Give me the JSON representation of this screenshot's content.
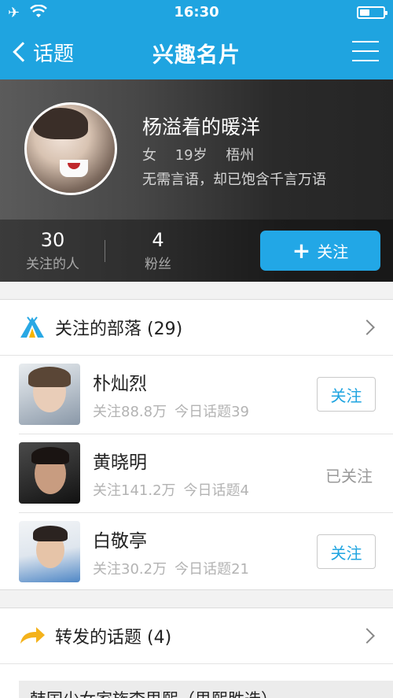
{
  "status_bar": {
    "time": "16:30"
  },
  "nav": {
    "back_label": "话题",
    "title": "兴趣名片"
  },
  "profile": {
    "name": "杨溢着的暖洋",
    "gender": "女",
    "age": "19岁",
    "city": "梧州",
    "signature": "无需言语，却已饱含千言万语",
    "following_count": "30",
    "following_label": "关注的人",
    "fans_count": "4",
    "fans_label": "粉丝",
    "follow_button": "关注"
  },
  "tribes": {
    "title": "关注的部落 (29)",
    "items": [
      {
        "name": "朴灿烈",
        "followers": "关注88.8万",
        "topics": "今日话题39",
        "action": "关注",
        "followed": false
      },
      {
        "name": "黄晓明",
        "followers": "关注141.2万",
        "topics": "今日话题4",
        "action": "已关注",
        "followed": true
      },
      {
        "name": "白敬亭",
        "followers": "关注30.2万",
        "topics": "今日话题21",
        "action": "关注",
        "followed": false
      }
    ]
  },
  "forwarded": {
    "title": "转发的话题 (4)",
    "first_item": "韩国少女家族李思熙（思熙胜选）"
  },
  "colors": {
    "accent": "#1fa4e0",
    "follow_button": "#22a7e6"
  }
}
